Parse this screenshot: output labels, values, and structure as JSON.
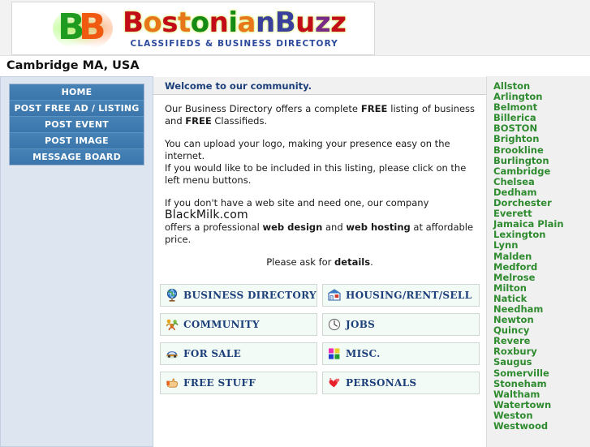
{
  "header": {
    "logo_mark": "bb-monogram-icon",
    "logo_text_parts": [
      "B",
      "o",
      "s",
      "t",
      "o",
      "n",
      "i",
      "a",
      "n",
      "B",
      "u",
      "z",
      "z"
    ],
    "logo_text": "BostonianBuzz",
    "logo_tagline": "CLASSIFIEDS & BUSINESS DIRECTORY",
    "location": "Cambridge MA, USA"
  },
  "sidebar": {
    "items": [
      {
        "label": "HOME"
      },
      {
        "label": "POST FREE AD / LISTING"
      },
      {
        "label": "POST EVENT"
      },
      {
        "label": "POST IMAGE"
      },
      {
        "label": "MESSAGE BOARD"
      }
    ]
  },
  "main": {
    "welcome_title": "Welcome to our community.",
    "paragraph_1_pre": "Our Business Directory offers a complete ",
    "paragraph_1_b1": "FREE",
    "paragraph_1_mid": " listing of  business and ",
    "paragraph_1_b2": "FREE",
    "paragraph_1_end": " Classifieds.",
    "paragraph_2_line1": "You can upload your logo, making your presence easy on the internet.",
    "paragraph_2_line2": "If you would like to be included in this listing, please click on the left menu buttons.",
    "paragraph_3_pre": "If you don't have a web site and need one, our company ",
    "paragraph_3_brand": "BlackMilk.com",
    "paragraph_3_mid": "offers a professional ",
    "paragraph_3_b1": "web design",
    "paragraph_3_and": " and ",
    "paragraph_3_b2": "web hosting",
    "paragraph_3_end": " at affordable price.",
    "paragraph_4_pre": "Please ask for ",
    "paragraph_4_b": "details",
    "paragraph_4_end": ".",
    "categories": [
      {
        "label": "BUSINESS DIRECTORY",
        "icon": "globe-icon"
      },
      {
        "label": "HOUSING/RENT/SELL",
        "icon": "house-icon"
      },
      {
        "label": "COMMUNITY",
        "icon": "people-icon"
      },
      {
        "label": "JOBS",
        "icon": "clock-icon"
      },
      {
        "label": "FOR SALE",
        "icon": "car-icon"
      },
      {
        "label": "MISC.",
        "icon": "color-squares-icon"
      },
      {
        "label": "FREE STUFF",
        "icon": "pointing-hand-icon"
      },
      {
        "label": "PERSONALS",
        "icon": "hearts-icon"
      }
    ]
  },
  "cities": [
    "Allston",
    "Arlington",
    "Belmont",
    "Billerica",
    "BOSTON",
    "Brighton",
    "Brookline",
    "Burlington",
    "Cambridge",
    "Chelsea",
    "Dedham",
    "Dorchester",
    "Everett",
    "Jamaica Plain",
    "Lexington",
    "Lynn",
    "Malden",
    "Medford",
    "Melrose",
    "Milton",
    "Natick",
    "Needham",
    "Newton",
    "Quincy",
    "Revere",
    "Roxbury",
    "Saugus",
    "Somerville",
    "Stoneham",
    "Waltham",
    "Watertown",
    "Weston",
    "Westwood"
  ],
  "colors": {
    "nav_blue": "#3f7cb0",
    "left_panel": "#dde5f1",
    "city_green": "#2f8b2f",
    "heading_blue": "#1d3f7a",
    "category_bg": "#f2fbf5"
  }
}
